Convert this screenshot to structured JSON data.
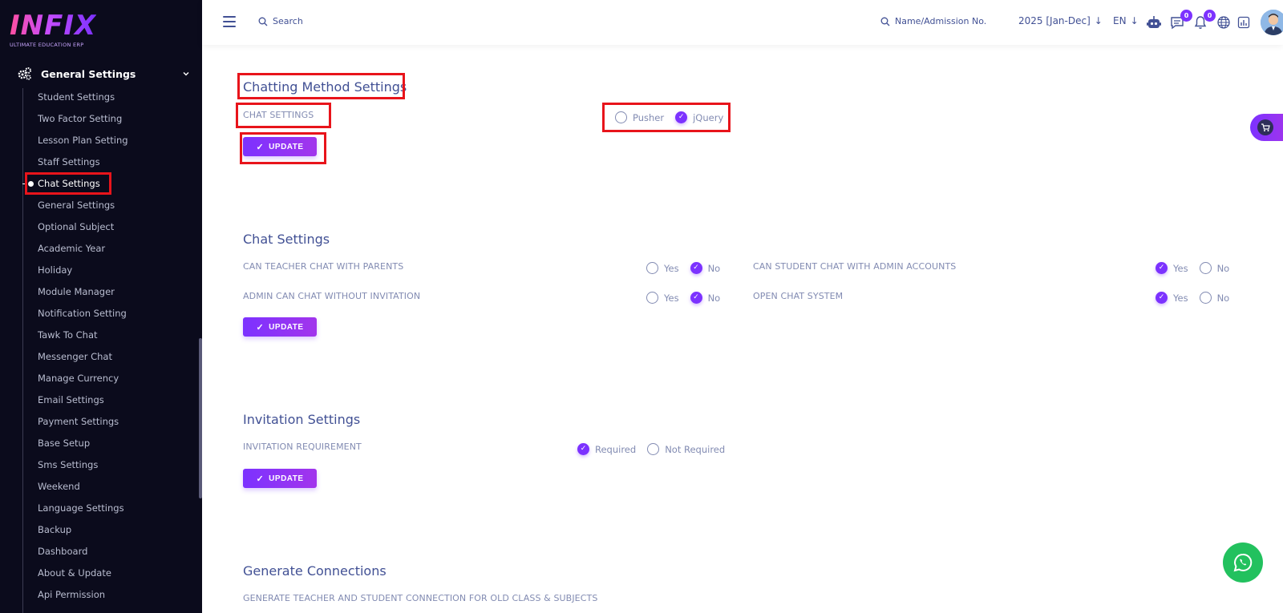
{
  "logo": {
    "text": "INFIX",
    "subtitle": "ULTIMATE EDUCATION ERP"
  },
  "sidebar": {
    "parent_label": "General Settings",
    "items": [
      "Student Settings",
      "Two Factor Setting",
      "Lesson Plan Setting",
      "Staff Settings",
      "Chat Settings",
      "General Settings",
      "Optional Subject",
      "Academic Year",
      "Holiday",
      "Module Manager",
      "Notification Setting",
      "Tawk To Chat",
      "Messenger Chat",
      "Manage Currency",
      "Email Settings",
      "Payment Settings",
      "Base Setup",
      "Sms Settings",
      "Weekend",
      "Language Settings",
      "Backup",
      "Dashboard",
      "About & Update",
      "Api Permission"
    ],
    "active_index": 4
  },
  "header": {
    "search_label": "Search",
    "student_search_label": "Name/Admission No.",
    "academic_year": "2025 [Jan-Dec]",
    "language": "EN",
    "messages_count": "0",
    "notifications_count": "0"
  },
  "chatting_method": {
    "title": "Chatting Method Settings",
    "label": "CHAT SETTINGS",
    "options": [
      "Pusher",
      "jQuery"
    ],
    "selected": "jQuery",
    "button": "UPDATE"
  },
  "chat_settings": {
    "title": "Chat Settings",
    "rows": [
      {
        "label": "CAN TEACHER CHAT WITH PARENTS",
        "yes": "Yes",
        "no": "No",
        "value": "No"
      },
      {
        "label": "CAN STUDENT CHAT WITH ADMIN ACCOUNTS",
        "yes": "Yes",
        "no": "No",
        "value": "Yes"
      },
      {
        "label": "ADMIN CAN CHAT WITHOUT INVITATION",
        "yes": "Yes",
        "no": "No",
        "value": "No"
      },
      {
        "label": "OPEN CHAT SYSTEM",
        "yes": "Yes",
        "no": "No",
        "value": "Yes"
      }
    ],
    "button": "UPDATE"
  },
  "invitation_settings": {
    "title": "Invitation Settings",
    "label": "INVITATION REQUIREMENT",
    "options": [
      "Required",
      "Not Required"
    ],
    "selected": "Required",
    "button": "UPDATE"
  },
  "generate_connections": {
    "title": "Generate Connections",
    "label": "GENERATE TEACHER AND STUDENT CONNECTION FOR OLD CLASS & SUBJECTS"
  },
  "colors": {
    "accent": "#7c32ff",
    "sidebar_bg": "#0b0b1c",
    "text": "#415094",
    "muted": "#828bb2",
    "highlight_box": "#e8141b",
    "whatsapp": "#22c15e"
  }
}
